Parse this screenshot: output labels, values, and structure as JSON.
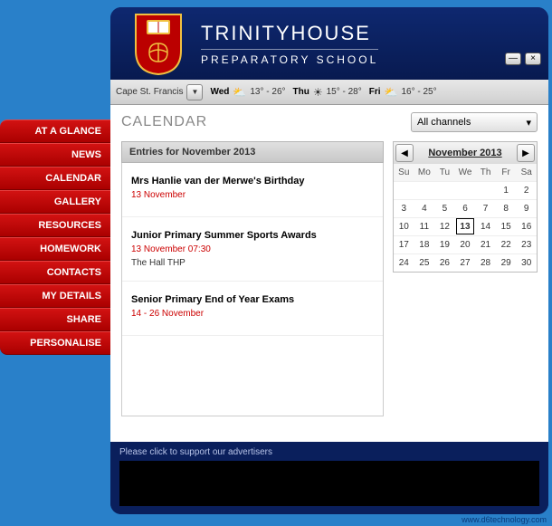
{
  "brand": {
    "title": "TRINITYHOUSE",
    "subtitle": "PREPARATORY SCHOOL"
  },
  "window_controls": {
    "min": "—",
    "close": "×"
  },
  "infobar": {
    "location": "Cape St. Francis",
    "forecast": [
      {
        "day": "Wed",
        "icon": "⛅",
        "temp": "13° - 26°"
      },
      {
        "day": "Thu",
        "icon": "☀",
        "temp": "15° - 28°"
      },
      {
        "day": "Fri",
        "icon": "⛅",
        "temp": "16° - 25°"
      }
    ]
  },
  "sidebar": {
    "items": [
      {
        "label": "AT A GLANCE"
      },
      {
        "label": "NEWS"
      },
      {
        "label": "CALENDAR"
      },
      {
        "label": "GALLERY"
      },
      {
        "label": "RESOURCES"
      },
      {
        "label": "HOMEWORK"
      },
      {
        "label": "CONTACTS"
      },
      {
        "label": "MY DETAILS"
      },
      {
        "label": "SHARE"
      },
      {
        "label": "PERSONALISE"
      }
    ]
  },
  "main": {
    "page_title": "CALENDAR",
    "channel_filter": {
      "value": "All channels"
    },
    "entries_header": "Entries for November 2013",
    "entries": [
      {
        "title": "Mrs Hanlie van der Merwe's Birthday",
        "date": "13 November",
        "location": ""
      },
      {
        "title": "Junior Primary Summer Sports Awards",
        "date": "13 November 07:30",
        "location": "The Hall THP"
      },
      {
        "title": "Senior Primary End of Year Exams",
        "date": "14 - 26 November",
        "location": ""
      }
    ],
    "calendar": {
      "title": "November 2013",
      "dow": [
        "Su",
        "Mo",
        "Tu",
        "We",
        "Th",
        "Fr",
        "Sa"
      ],
      "rows": [
        [
          {
            "n": "",
            "m": true
          },
          {
            "n": "",
            "m": true
          },
          {
            "n": "",
            "m": true
          },
          {
            "n": "",
            "m": true
          },
          {
            "n": "",
            "m": true
          },
          {
            "n": "1"
          },
          {
            "n": "2"
          }
        ],
        [
          {
            "n": "3"
          },
          {
            "n": "4"
          },
          {
            "n": "5"
          },
          {
            "n": "6"
          },
          {
            "n": "7"
          },
          {
            "n": "8"
          },
          {
            "n": "9"
          }
        ],
        [
          {
            "n": "10"
          },
          {
            "n": "11"
          },
          {
            "n": "12"
          },
          {
            "n": "13",
            "today": true
          },
          {
            "n": "14"
          },
          {
            "n": "15"
          },
          {
            "n": "16"
          }
        ],
        [
          {
            "n": "17"
          },
          {
            "n": "18"
          },
          {
            "n": "19"
          },
          {
            "n": "20"
          },
          {
            "n": "21"
          },
          {
            "n": "22"
          },
          {
            "n": "23"
          }
        ],
        [
          {
            "n": "24"
          },
          {
            "n": "25"
          },
          {
            "n": "26"
          },
          {
            "n": "27"
          },
          {
            "n": "28"
          },
          {
            "n": "29"
          },
          {
            "n": "30"
          }
        ]
      ]
    }
  },
  "footer": {
    "ad_prompt": "Please click to support our advertisers"
  },
  "credit": "www.d6technology.com"
}
